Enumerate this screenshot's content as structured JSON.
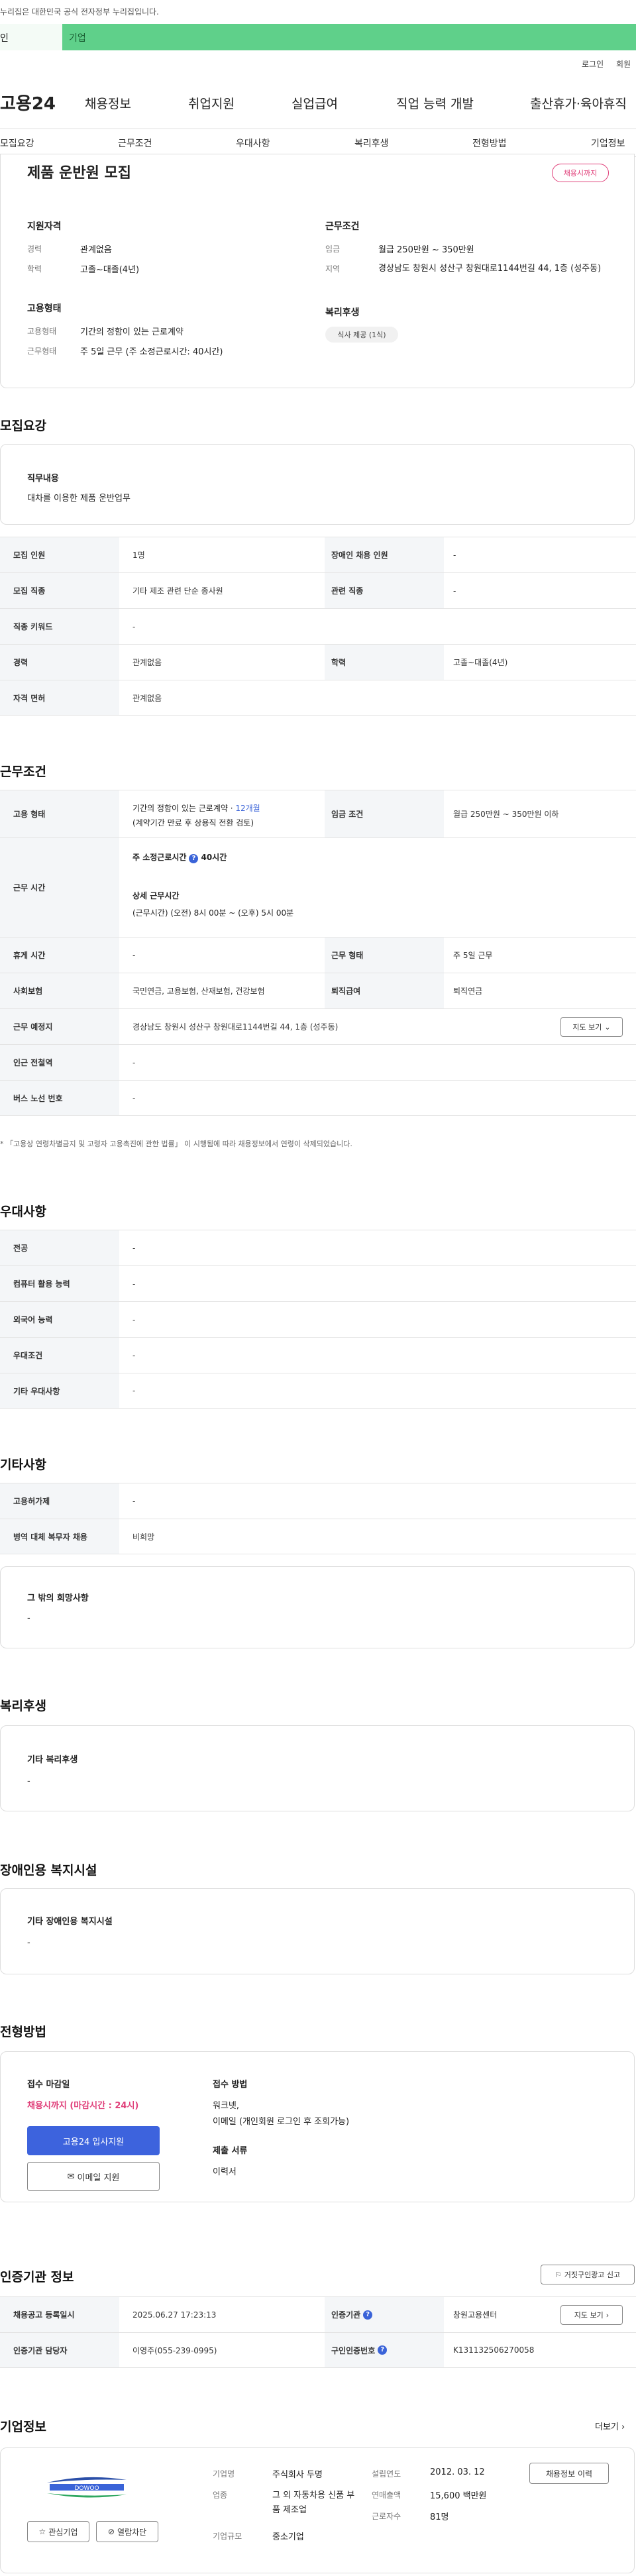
{
  "banner": {
    "text": "누리집은 대한민국 공식 전자정부 누리집입니다."
  },
  "top_tabs": [
    {
      "label": "인"
    },
    {
      "label": "기업"
    }
  ],
  "util": {
    "login": "로그인",
    "signup": "회원"
  },
  "header": {
    "logo": "고용24",
    "gnb": [
      "채용정보",
      "취업지원",
      "실업급여",
      "직업 능력 개발",
      "출산휴가·육아휴직"
    ]
  },
  "subnav": [
    "모집요강",
    "근무조건",
    "우대사항",
    "복리후생",
    "전형방법",
    "기업정보"
  ],
  "summary": {
    "title": "제품 운반원 모집",
    "status_badge": "채용시까지",
    "qual_heading": "지원자격",
    "qual": [
      {
        "label": "경력",
        "value": "관계없음"
      },
      {
        "label": "학력",
        "value": "고졸~대졸(4년)"
      }
    ],
    "emp_heading": "고용형태",
    "emp": [
      {
        "label": "고용형태",
        "value": "기간의 정함이 있는 근로계약"
      },
      {
        "label": "근무형태",
        "value": "주 5일 근무 (주 소정근로시간: 40시간)"
      }
    ],
    "cond_heading": "근무조건",
    "cond": [
      {
        "label": "임금",
        "value": "월급 250만원 ~ 350만원"
      },
      {
        "label": "지역",
        "value": "경상남도 창원시 성산구 창원대로1144번길 44, 1층 (성주동)"
      }
    ],
    "welfare_heading": "복리후생",
    "welfare_tag": "식사 제공 (1식)"
  },
  "recruit": {
    "heading": "모집요강",
    "duty_label": "직무내용",
    "duty_value": "대차를 이용한 제품 운반업무",
    "rows": [
      {
        "k1": "모집 인원",
        "v1": "1명",
        "k2": "장애인 채용 인원",
        "v2": "-"
      },
      {
        "k1": "모집 직종",
        "v1": "기타 제조 관련 단순 종사원",
        "k2": "관련 직종",
        "v2": "-"
      },
      {
        "k1": "직종 키워드",
        "v1": "-"
      },
      {
        "k1": "경력",
        "v1": "관계없음",
        "k2": "학력",
        "v2": "고졸~대졸(4년)"
      },
      {
        "k1": "자격 면허",
        "v1": "관계없음"
      }
    ]
  },
  "work": {
    "heading": "근무조건",
    "emp_type_label": "고용 형태",
    "emp_type_value": "기간의 정함이 있는 근로계약 · ",
    "emp_type_months": "12개월",
    "emp_type_note": "(계약기간 만료 후 상용직 전환 검토)",
    "wage_label": "임금 조건",
    "wage_value": "월급 250만원 ~ 350만원 이하",
    "hours_label": "근무 시간",
    "hours_weekly": "주 소정근로시간",
    "hours_weekly_value": "40시간",
    "hours_detail_label": "상세 근무시간",
    "hours_detail_value": "(근무시간) (오전) 8시 00분 ~ (오후) 5시 00분",
    "holiday_label": "휴게 시간",
    "holiday_value": "-",
    "worktype_label": "근무 형태",
    "worktype_value": "주 5일 근무",
    "insurance_label": "사회보험",
    "insurance_value": "국민연금, 고용보험, 산재보험, 건강보험",
    "severance_label": "퇴직급여",
    "severance_value": "퇴직연금",
    "location_label": "근무 예정지",
    "location_value": "경상남도 창원시 성산구 창원대로1144번길 44, 1층 (성주동)",
    "map_button": "지도 보기",
    "station_label": "인근 전철역",
    "station_value": "-",
    "bus_label": "버스 노선 번호",
    "bus_value": "-",
    "footnote": "* 「고용상 연령차별금지 및 고령자 고용촉진에 관한 법률」 이 시행됨에 따라 채용정보에서 연령이 삭제되었습니다."
  },
  "preferred": {
    "heading": "우대사항",
    "rows": [
      {
        "k": "전공",
        "v": "-"
      },
      {
        "k": "컴퓨터 활용 능력",
        "v": "-"
      },
      {
        "k": "외국어 능력",
        "v": "-"
      },
      {
        "k": "우대조건",
        "v": "-"
      },
      {
        "k": "기타 우대사항",
        "v": "-"
      }
    ]
  },
  "etc": {
    "heading": "기타사항",
    "rows": [
      {
        "k": "고용허가제",
        "v": "-"
      },
      {
        "k": "병역 대체 복무자 채용",
        "v": "비희망"
      }
    ],
    "hope_label": "그 밖의 희망사항",
    "hope_value": "-"
  },
  "welfare": {
    "heading": "복리후생",
    "label": "기타 복리후생",
    "value": "-"
  },
  "disability": {
    "heading": "장애인용 복지시설",
    "label": "기타 장애인용 복지시설",
    "value": "-"
  },
  "apply": {
    "heading": "전형방법",
    "deadline_label": "접수 마감일",
    "deadline_value": "채용시까지 (마감시간 : 24시)",
    "apply_button": "고용24 입사지원",
    "email_button": "이메일 지원",
    "method_label": "접수 방법",
    "method_value": "워크넷,\n이메일 (개인회원 로그인 후 조회가능)",
    "docs_label": "제출 서류",
    "docs_value": "이력서"
  },
  "cert": {
    "heading": "인증기관 정보",
    "report_button": "거짓구인광고 신고",
    "rows": [
      {
        "k1": "채용공고 등록일시",
        "v1": "2025.06.27 17:23:13",
        "k2": "인증기관",
        "v2": "창원고용센터",
        "btn": "지도 보기"
      },
      {
        "k1": "인증기관 담당자",
        "v1": "이영주(055-239-0995)",
        "k2": "구인인증번호",
        "v2": "K131132506270058"
      }
    ]
  },
  "company": {
    "heading": "기업정보",
    "more": "더보기",
    "logo_text": "DOWOO",
    "fav_button": "관심기업",
    "block_button": "열람차단",
    "fields": [
      {
        "k": "기업명",
        "v": "주식회사 두명"
      },
      {
        "k": "업종",
        "v": "그 외 자동차용 신품 부품 제조업"
      },
      {
        "k": "기업규모",
        "v": "중소기업"
      }
    ],
    "fields2": [
      {
        "k": "설립연도",
        "v": "2012. 03. 12"
      },
      {
        "k": "연매출액",
        "v": "15,600 백만원"
      },
      {
        "k": "근로자수",
        "v": "81명"
      }
    ],
    "history_button": "채용정보 이력"
  }
}
